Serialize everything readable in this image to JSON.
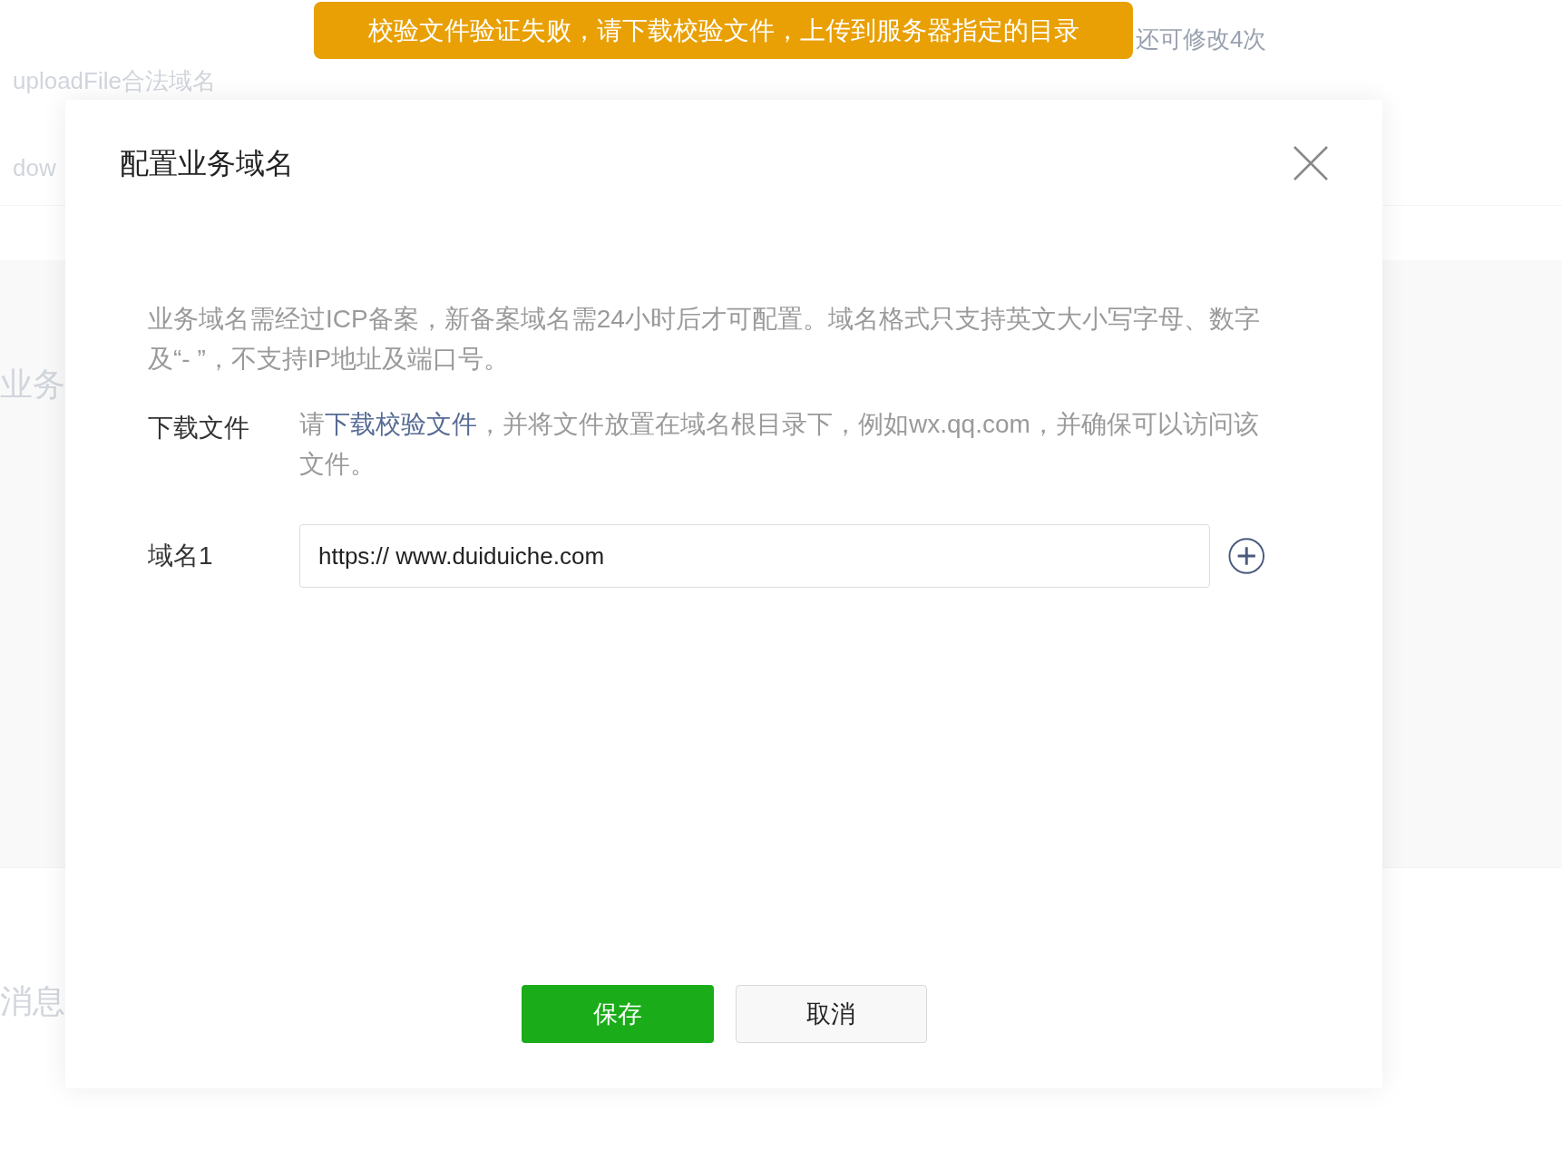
{
  "background": {
    "labels": [
      "uploadFile合法域名",
      "dow",
      "业务",
      "消息"
    ],
    "note": "还可修改4次"
  },
  "toast": {
    "text": "校验文件验证失败，请下载校验文件，上传到服务器指定的目录"
  },
  "dialog": {
    "title": "配置业务域名",
    "description": "业务域名需经过ICP备案，新备案域名需24小时后才可配置。域名格式只支持英文大小写字母、数字及“- ”，不支持IP地址及端口号。",
    "download": {
      "label": "下载文件",
      "before": "请",
      "link": "下载校验文件",
      "after": "，并将文件放置在域名根目录下，例如wx.qq.com，并确保可以访问该文件。"
    },
    "domains": [
      {
        "label": "域名1",
        "value": "https:// www.duiduiche.com"
      }
    ],
    "buttons": [
      {
        "kind": "primary",
        "label": "保存"
      },
      {
        "kind": "secondary",
        "label": "取消"
      }
    ]
  }
}
